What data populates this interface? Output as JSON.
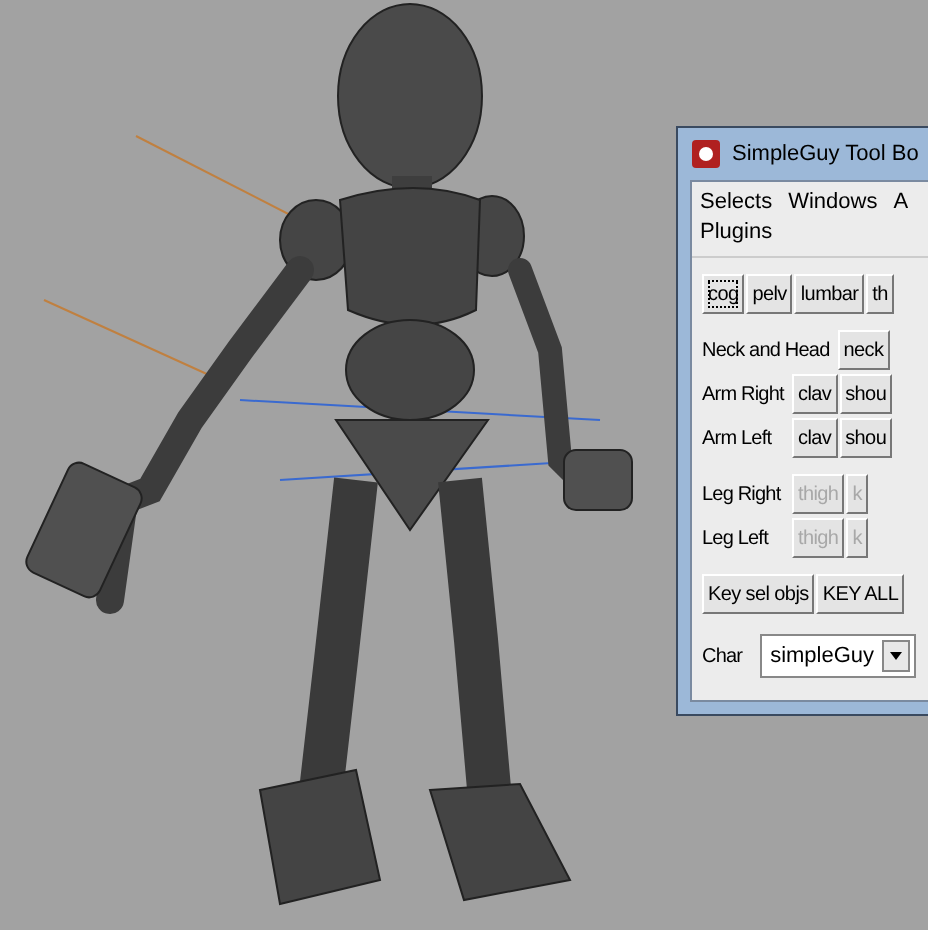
{
  "window": {
    "title": "SimpleGuy Tool Bo"
  },
  "menu": [
    {
      "label": "Selects"
    },
    {
      "label": "Windows"
    },
    {
      "label": "A"
    },
    {
      "label": "Plugins"
    }
  ],
  "top_buttons": [
    {
      "label": "cog",
      "focused": true
    },
    {
      "label": "pelv",
      "focused": false
    },
    {
      "label": "lumbar",
      "focused": false
    },
    {
      "label": "th",
      "focused": false
    }
  ],
  "neck_row": {
    "label": "Neck and Head",
    "buttons": [
      {
        "label": "neck",
        "disabled": false
      }
    ]
  },
  "limb_rows": [
    {
      "label": "Arm Right",
      "buttons": [
        {
          "label": "clav",
          "disabled": false
        },
        {
          "label": "shou",
          "disabled": false
        }
      ]
    },
    {
      "label": "Arm Left",
      "buttons": [
        {
          "label": "clav",
          "disabled": false
        },
        {
          "label": "shou",
          "disabled": false
        }
      ]
    },
    {
      "label": "Leg Right",
      "buttons": [
        {
          "label": "thigh",
          "disabled": true
        },
        {
          "label": "k",
          "disabled": true
        }
      ]
    },
    {
      "label": "Leg Left",
      "buttons": [
        {
          "label": "thigh",
          "disabled": true
        },
        {
          "label": "k",
          "disabled": true
        }
      ]
    }
  ],
  "key_buttons": [
    {
      "label": "Key sel objs"
    },
    {
      "label": "KEY ALL"
    }
  ],
  "char": {
    "label": "Char",
    "value": "simpleGuy"
  }
}
